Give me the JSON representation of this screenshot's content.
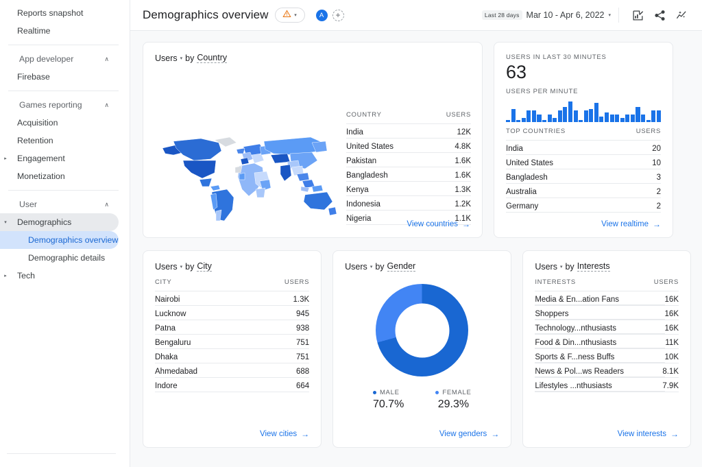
{
  "sidebar": {
    "items": [
      {
        "label": "Reports snapshot",
        "level": 1,
        "type": "item"
      },
      {
        "label": "Realtime",
        "level": 1,
        "type": "item"
      },
      {
        "type": "divider"
      },
      {
        "label": "App developer",
        "level": 0,
        "type": "group",
        "caret": "∧"
      },
      {
        "label": "Firebase",
        "level": 1,
        "type": "item"
      },
      {
        "type": "divider"
      },
      {
        "label": "Games reporting",
        "level": 0,
        "type": "group",
        "caret": "∧"
      },
      {
        "label": "Acquisition",
        "level": 1,
        "type": "item"
      },
      {
        "label": "Retention",
        "level": 1,
        "type": "item"
      },
      {
        "label": "Engagement",
        "level": 1,
        "type": "item",
        "twisty": "▸"
      },
      {
        "label": "Monetization",
        "level": 1,
        "type": "item"
      },
      {
        "type": "divider"
      },
      {
        "label": "User",
        "level": 0,
        "type": "group",
        "caret": "∧"
      },
      {
        "label": "Demographics",
        "level": 1,
        "type": "item",
        "twisty": "▾",
        "state": "expanded-parent"
      },
      {
        "label": "Demographics overview",
        "level": 1,
        "type": "item",
        "state": "selected",
        "indent": 2
      },
      {
        "label": "Demographic details",
        "level": 1,
        "type": "item",
        "indent": 2
      },
      {
        "label": "Tech",
        "level": 1,
        "type": "item",
        "twisty": "▸"
      }
    ]
  },
  "topbar": {
    "title": "Demographics overview",
    "warning_icon": "warning-triangle-icon",
    "warning_chevron": "▾",
    "avatar_initial": "A",
    "add_label": "+",
    "date_badge": "Last 28 days",
    "date_range": "Mar 10 - Apr 6, 2022",
    "date_chevron": "▾",
    "icons": [
      "customize-report-icon",
      "share-icon",
      "insights-icon"
    ]
  },
  "country_card": {
    "metric": "Users",
    "by_text": "by",
    "dimension": "Country",
    "columns": [
      "COUNTRY",
      "USERS"
    ],
    "rows": [
      {
        "name": "India",
        "value": "12K",
        "pct": 100
      },
      {
        "name": "United States",
        "value": "4.8K",
        "pct": 40
      },
      {
        "name": "Pakistan",
        "value": "1.6K",
        "pct": 14
      },
      {
        "name": "Bangladesh",
        "value": "1.6K",
        "pct": 13
      },
      {
        "name": "Kenya",
        "value": "1.3K",
        "pct": 11
      },
      {
        "name": "Indonesia",
        "value": "1.2K",
        "pct": 10
      },
      {
        "name": "Nigeria",
        "value": "1.1K",
        "pct": 9
      }
    ],
    "view_link": "View countries",
    "arrow": "→"
  },
  "realtime_card": {
    "header": "USERS IN LAST 30 MINUTES",
    "big_number": "63",
    "subheader": "USERS PER MINUTE",
    "columns": [
      "TOP COUNTRIES",
      "USERS"
    ],
    "rows": [
      {
        "name": "India",
        "value": "20",
        "pct": 100
      },
      {
        "name": "United States",
        "value": "10",
        "pct": 50
      },
      {
        "name": "Bangladesh",
        "value": "3",
        "pct": 15
      },
      {
        "name": "Australia",
        "value": "2",
        "pct": 10
      },
      {
        "name": "Germany",
        "value": "2",
        "pct": 10
      }
    ],
    "view_link": "View realtime",
    "arrow": "→"
  },
  "city_card": {
    "metric": "Users",
    "by_text": "by",
    "dimension": "City",
    "columns": [
      "CITY",
      "USERS"
    ],
    "rows": [
      {
        "name": "Nairobi",
        "value": "1.3K",
        "pct": 100
      },
      {
        "name": "Lucknow",
        "value": "945",
        "pct": 73
      },
      {
        "name": "Patna",
        "value": "938",
        "pct": 72
      },
      {
        "name": "Bengaluru",
        "value": "751",
        "pct": 58
      },
      {
        "name": "Dhaka",
        "value": "751",
        "pct": 58
      },
      {
        "name": "Ahmedabad",
        "value": "688",
        "pct": 53
      },
      {
        "name": "Indore",
        "value": "664",
        "pct": 51
      }
    ],
    "view_link": "View cities",
    "arrow": "→"
  },
  "gender_card": {
    "metric": "Users",
    "by_text": "by",
    "dimension": "Gender",
    "legend": [
      {
        "label": "MALE",
        "value": "70.7%",
        "color": "#1967d2"
      },
      {
        "label": "FEMALE",
        "value": "29.3%",
        "color": "#4285f4"
      }
    ],
    "view_link": "View genders",
    "arrow": "→"
  },
  "interests_card": {
    "metric": "Users",
    "by_text": "by",
    "dimension": "Interests",
    "columns": [
      "INTERESTS",
      "USERS"
    ],
    "rows": [
      {
        "name": "Media & En...ation Fans",
        "value": "16K",
        "pct": 100
      },
      {
        "name": "Shoppers",
        "value": "16K",
        "pct": 99
      },
      {
        "name": "Technology...nthusiasts",
        "value": "16K",
        "pct": 96
      },
      {
        "name": "Food & Din...nthusiasts",
        "value": "11K",
        "pct": 70
      },
      {
        "name": "Sports & F...ness Buffs",
        "value": "10K",
        "pct": 58
      },
      {
        "name": "News & Pol...ws Readers",
        "value": "8.1K",
        "pct": 46
      },
      {
        "name": "Lifestyles ...nthusiasts",
        "value": "7.9K",
        "pct": 45
      }
    ],
    "view_link": "View interests",
    "arrow": "→"
  },
  "chart_data": [
    {
      "type": "bar",
      "title": "USERS PER MINUTE",
      "categories": [
        "1",
        "2",
        "3",
        "4",
        "5",
        "6",
        "7",
        "8",
        "9",
        "10",
        "11",
        "12",
        "13",
        "14",
        "15",
        "16",
        "17",
        "18",
        "19",
        "20",
        "21",
        "22",
        "23",
        "24",
        "25",
        "26",
        "27",
        "28",
        "29",
        "30"
      ],
      "values": [
        1,
        7,
        1,
        2,
        6,
        6,
        4,
        1,
        4,
        2,
        6,
        8,
        11,
        6,
        1,
        6,
        7,
        10,
        3,
        5,
        4,
        4,
        2,
        4,
        4,
        8,
        4,
        1,
        6,
        6
      ],
      "xlabel": "",
      "ylabel": "Users",
      "ylim": [
        0,
        11
      ],
      "grid": false,
      "legend": "none"
    },
    {
      "type": "pie",
      "title": "Users by Gender",
      "categories": [
        "MALE",
        "FEMALE"
      ],
      "values": [
        70.7,
        29.3
      ],
      "colors": [
        "#1967d2",
        "#4285f4"
      ],
      "legend": "bottom",
      "donut": true
    },
    {
      "type": "bar",
      "title": "Users by Country",
      "categories": [
        "India",
        "United States",
        "Pakistan",
        "Bangladesh",
        "Kenya",
        "Indonesia",
        "Nigeria"
      ],
      "values": [
        12000,
        4800,
        1600,
        1600,
        1300,
        1200,
        1100
      ],
      "xlabel": "USERS",
      "ylabel": "COUNTRY",
      "grid": false,
      "legend": "none"
    },
    {
      "type": "bar",
      "title": "Users by City",
      "categories": [
        "Nairobi",
        "Lucknow",
        "Patna",
        "Bengaluru",
        "Dhaka",
        "Ahmedabad",
        "Indore"
      ],
      "values": [
        1300,
        945,
        938,
        751,
        751,
        688,
        664
      ],
      "xlabel": "USERS",
      "ylabel": "CITY",
      "grid": false,
      "legend": "none"
    },
    {
      "type": "bar",
      "title": "Users by Interests",
      "categories": [
        "Media & En...ation Fans",
        "Shoppers",
        "Technology...nthusiasts",
        "Food & Din...nthusiasts",
        "Sports & F...ness Buffs",
        "News & Pol...ws Readers",
        "Lifestyles ...nthusiasts"
      ],
      "values": [
        16000,
        16000,
        16000,
        11000,
        10000,
        8100,
        7900
      ],
      "xlabel": "USERS",
      "ylabel": "INTERESTS",
      "grid": false,
      "legend": "none"
    },
    {
      "type": "heatmap",
      "title": "Users by Country (world choropleth)",
      "regions": [
        {
          "name": "India",
          "value": 12000
        },
        {
          "name": "United States",
          "value": 4800
        },
        {
          "name": "Pakistan",
          "value": 1600
        },
        {
          "name": "Bangladesh",
          "value": 1600
        },
        {
          "name": "Kenya",
          "value": 1300
        },
        {
          "name": "Indonesia",
          "value": 1200
        },
        {
          "name": "Nigeria",
          "value": 1100
        }
      ],
      "colors": [
        "#c6dafc",
        "#1a56c4"
      ]
    }
  ]
}
